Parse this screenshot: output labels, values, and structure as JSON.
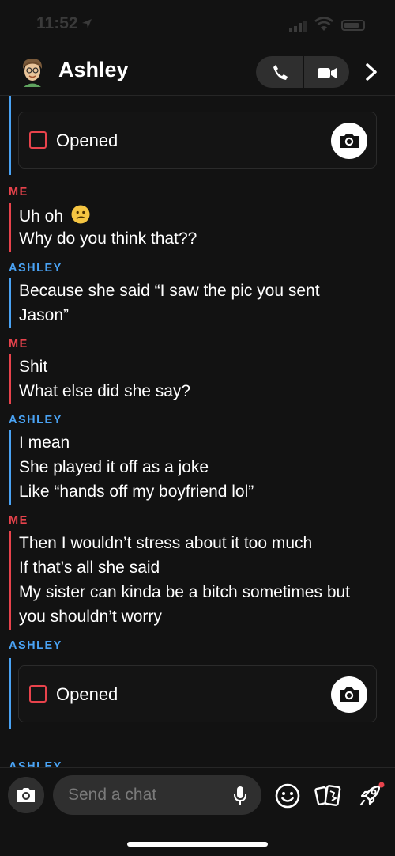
{
  "status_bar": {
    "time": "11:52"
  },
  "header": {
    "contact_name": "Ashley"
  },
  "messages": [
    {
      "sender": "ME",
      "lines": [
        "Uh oh",
        "Why do you think that??"
      ]
    },
    {
      "sender": "ASHLEY",
      "lines": [
        "Because she said “I saw the pic you sent",
        "Jason”"
      ]
    },
    {
      "sender": "ME",
      "lines": [
        "Shit",
        "What else did she say?"
      ]
    },
    {
      "sender": "ASHLEY",
      "lines": [
        "I mean",
        "She played it off as a joke",
        "Like “hands off my boyfriend lol”"
      ]
    },
    {
      "sender": "ME",
      "lines": [
        "Then I wouldn’t stress about it too much",
        "If that’s all she said",
        "My sister can kinda be a bitch sometimes but",
        "you shouldn’t worry"
      ]
    },
    {
      "sender": "ASHLEY"
    },
    {
      "sender": "ASHLEY"
    }
  ],
  "snaps": [
    {
      "status": "Opened"
    },
    {
      "status": "Opened"
    }
  ],
  "composer": {
    "placeholder": "Send a chat"
  },
  "colors": {
    "me": "#e8434c",
    "ashley": "#4aa3f4",
    "background": "#121212"
  }
}
